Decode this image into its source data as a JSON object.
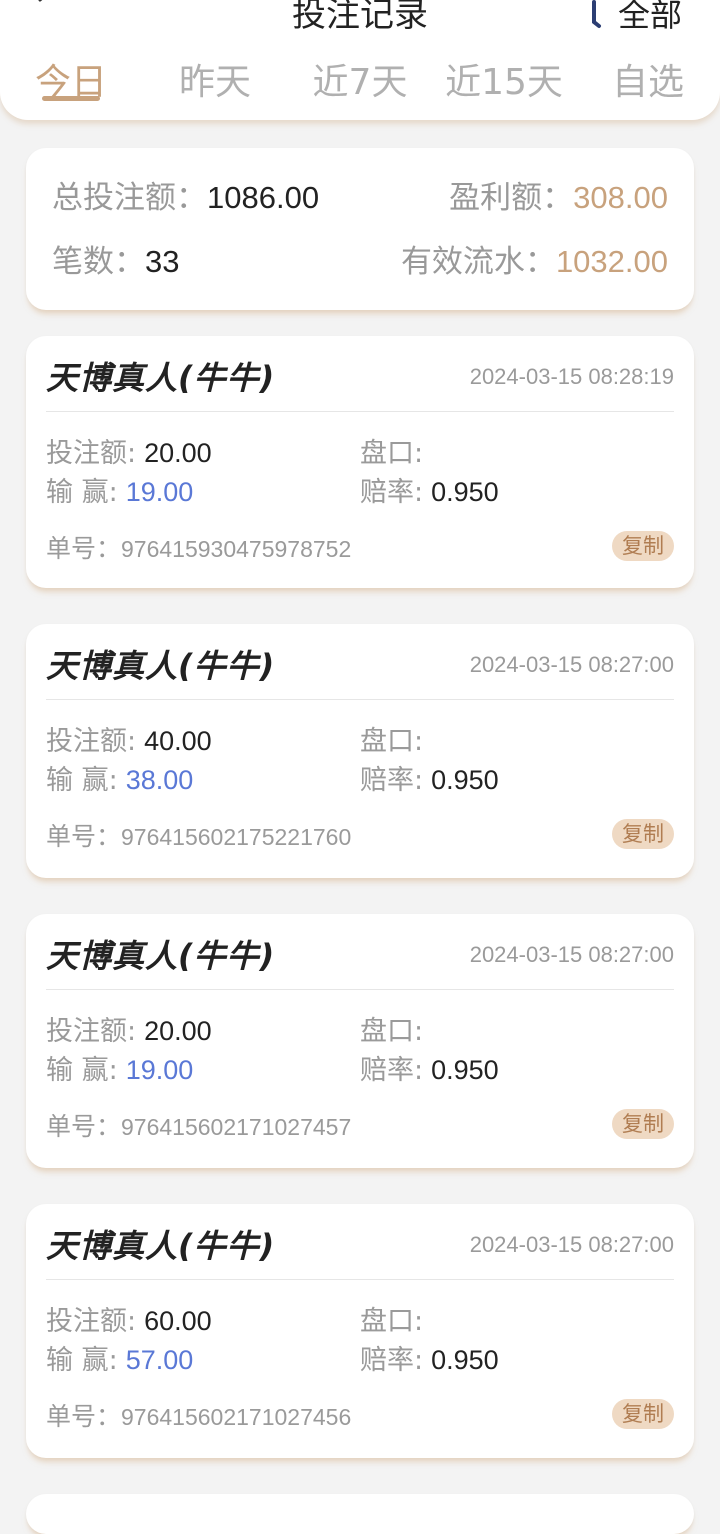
{
  "header": {
    "title": "投注记录",
    "filter_label": "全部"
  },
  "tabs": [
    "今日",
    "昨天",
    "近7天",
    "近15天",
    "自选"
  ],
  "active_tab": 0,
  "colors": {
    "accent": "#c8a27d",
    "win_blue": "#5a78d6"
  },
  "summary": {
    "total_bet_label": "总投注额：",
    "total_bet": "1086.00",
    "profit_label": "盈利额：",
    "profit": "308.00",
    "count_label": "笔数：",
    "count": "33",
    "turnover_label": "有效流水：",
    "turnover": "1032.00"
  },
  "labels": {
    "bet_amount": "投注额:",
    "handicap": "盘口:",
    "win_lose": "输 赢:",
    "odds": "赔率:",
    "order_no": "单号：",
    "copy": "复制"
  },
  "bets": [
    {
      "game": "天博真人(牛牛)",
      "time": "2024-03-15 08:28:19",
      "amount": "20.00",
      "handicap": "",
      "result": "19.00",
      "odds": "0.950",
      "order": "976415930475978752"
    },
    {
      "game": "天博真人(牛牛)",
      "time": "2024-03-15 08:27:00",
      "amount": "40.00",
      "handicap": "",
      "result": "38.00",
      "odds": "0.950",
      "order": "976415602175221760"
    },
    {
      "game": "天博真人(牛牛)",
      "time": "2024-03-15 08:27:00",
      "amount": "20.00",
      "handicap": "",
      "result": "19.00",
      "odds": "0.950",
      "order": "976415602171027457"
    },
    {
      "game": "天博真人(牛牛)",
      "time": "2024-03-15 08:27:00",
      "amount": "60.00",
      "handicap": "",
      "result": "57.00",
      "odds": "0.950",
      "order": "976415602171027456"
    }
  ]
}
